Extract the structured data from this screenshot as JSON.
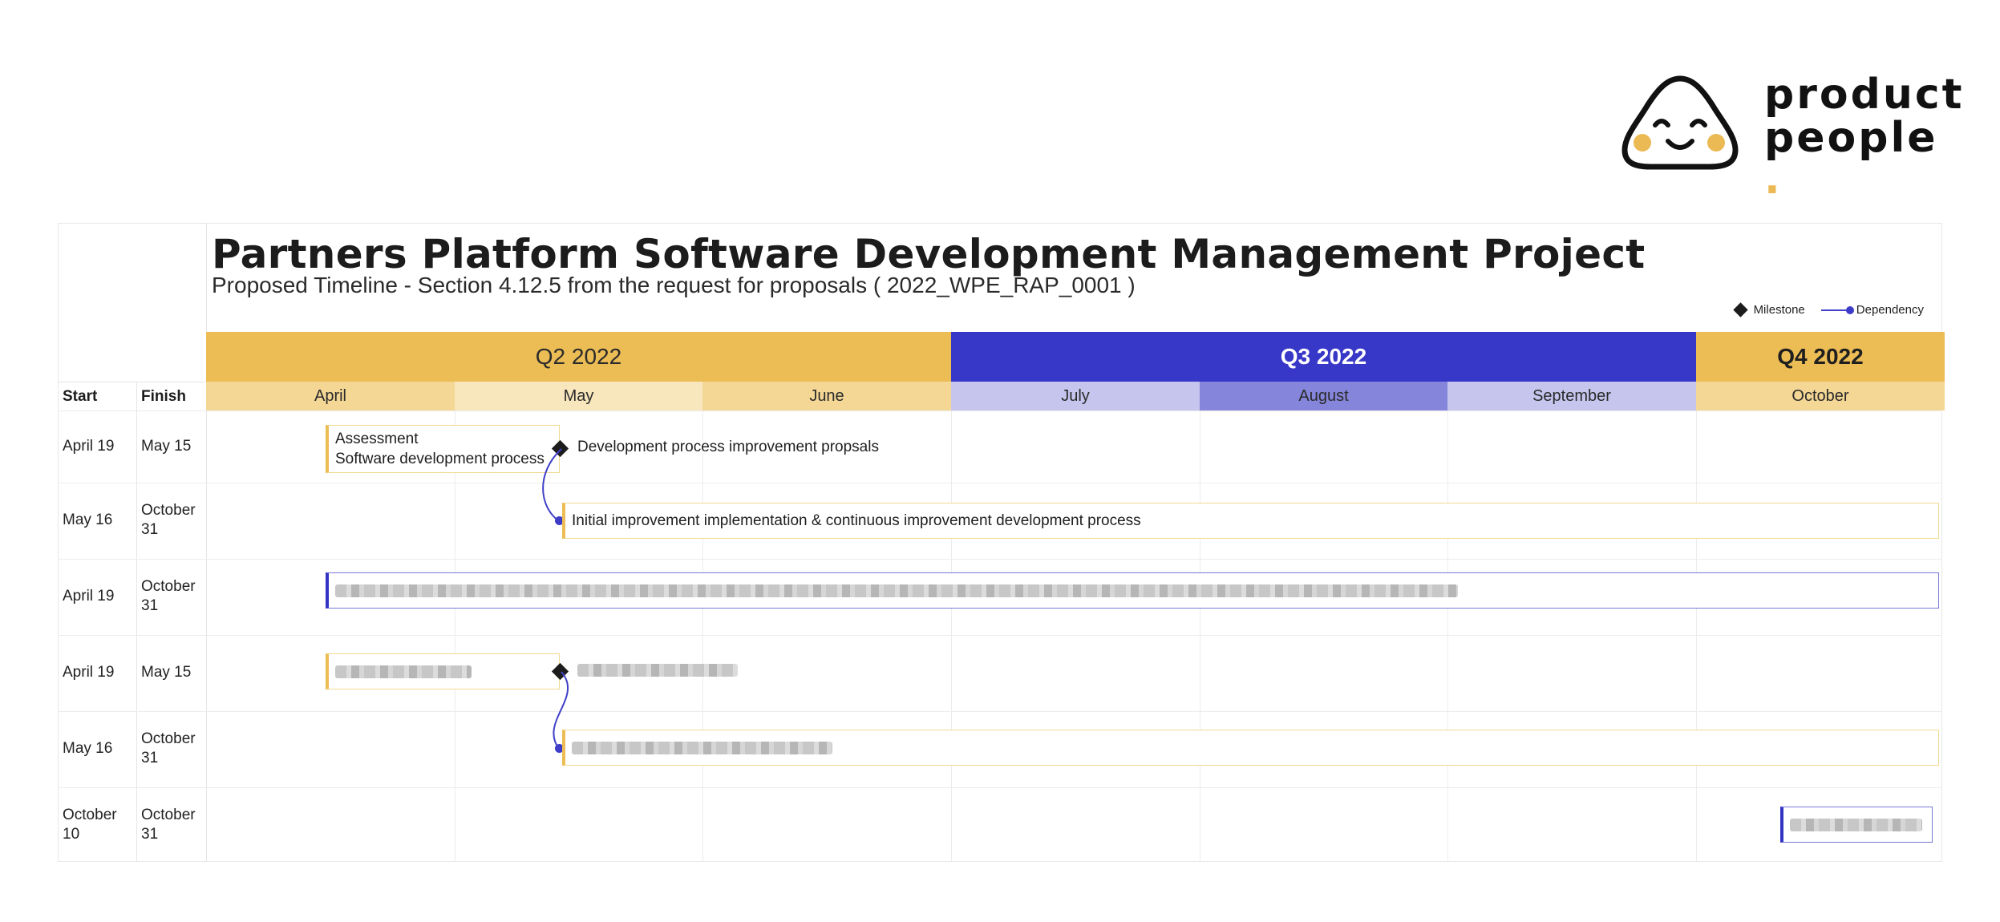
{
  "logo": {
    "line1": "product",
    "line2": "people",
    "dot": "."
  },
  "header": {
    "title": "Partners Platform Software Development Management Project",
    "subtitle": "Proposed Timeline - Section 4.12.5 from the request for proposals ( 2022_WPE_RAP_0001 )"
  },
  "legend": {
    "milestone": "Milestone",
    "dependency": "Dependency"
  },
  "columns": {
    "start": "Start",
    "finish": "Finish"
  },
  "quarters": [
    "Q2 2022",
    "Q3 2022",
    "Q4 2022"
  ],
  "months": [
    "April",
    "May",
    "June",
    "July",
    "August",
    "September",
    "October"
  ],
  "rows": [
    {
      "start": "April 19",
      "finish": "May 15",
      "task_line1": "Assessment",
      "task_line2": "Software development process",
      "milestone": "Development process improvement propsals"
    },
    {
      "start": "May 16",
      "finish": "October 31",
      "task": "Initial improvement implementation & continuous improvement development process"
    },
    {
      "start": "April 19",
      "finish": "October 31",
      "task": ""
    },
    {
      "start": "April 19",
      "finish": "May 15",
      "task": "",
      "milestone": ""
    },
    {
      "start": "May 16",
      "finish": "October 31",
      "task": ""
    },
    {
      "start": "October 10",
      "finish": "October 31",
      "task": ""
    }
  ],
  "colors": {
    "q2": "#ecbc55",
    "q3": "#3838c8",
    "q4": "#ecbc55",
    "month_light_yellow": "#f4d795",
    "month_pale_yellow": "#f8e6bd",
    "month_light_blue": "#c5c5ee",
    "month_mid_blue": "#8585dc",
    "dependency": "#3c3cc8",
    "milestone": "#1c1c1c"
  }
}
